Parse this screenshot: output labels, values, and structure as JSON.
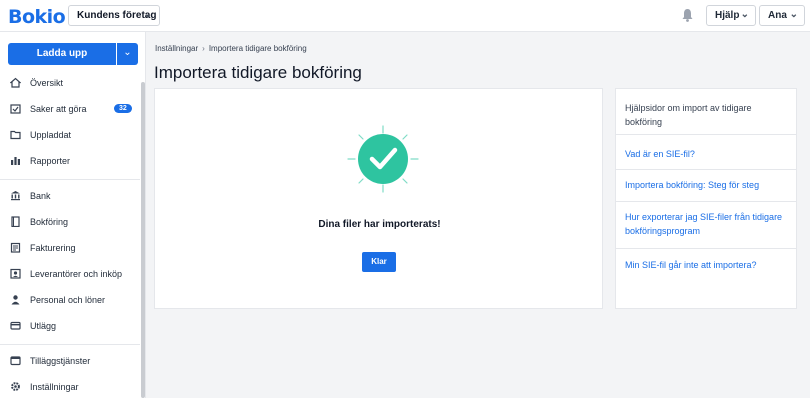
{
  "app": {
    "logo": "Bokio",
    "company_select": "Kundens företag",
    "help_label": "Hjälp",
    "user_label": "Ana"
  },
  "sidebar": {
    "upload_label": "Ladda upp",
    "items": [
      {
        "label": "Översikt",
        "icon": "home-icon"
      },
      {
        "label": "Saker att göra",
        "icon": "checklist-icon",
        "badge": "32"
      },
      {
        "label": "Uppladdat",
        "icon": "folder-icon"
      },
      {
        "label": "Rapporter",
        "icon": "bar-chart-icon"
      },
      {
        "label": "Bank",
        "icon": "bank-icon"
      },
      {
        "label": "Bokföring",
        "icon": "book-icon"
      },
      {
        "label": "Fakturering",
        "icon": "invoice-icon"
      },
      {
        "label": "Leverantörer och inköp",
        "icon": "supplier-icon"
      },
      {
        "label": "Personal och löner",
        "icon": "person-icon"
      },
      {
        "label": "Utlägg",
        "icon": "card-icon"
      },
      {
        "label": "Tilläggstjänster",
        "icon": "addon-icon"
      },
      {
        "label": "Inställningar",
        "icon": "gear-icon"
      }
    ]
  },
  "breadcrumb": {
    "parent": "Inställningar",
    "separator": "›",
    "current": "Importera tidigare bokföring"
  },
  "page_title": "Importera tidigare bokföring",
  "result": {
    "message": "Dina filer har importerats!",
    "done_label": "Klar"
  },
  "help": {
    "heading": "Hjälpsidor om import av tidigare bokföring",
    "links": [
      "Vad är en SIE-fil?",
      "Importera bokföring: Steg för steg",
      "Hur exporterar jag SIE-filer från tidigare bokföringsprogram",
      "Min SIE-fil går inte att importera?"
    ]
  },
  "colors": {
    "brand": "#1a6ee6",
    "success": "#2ec4a0"
  }
}
